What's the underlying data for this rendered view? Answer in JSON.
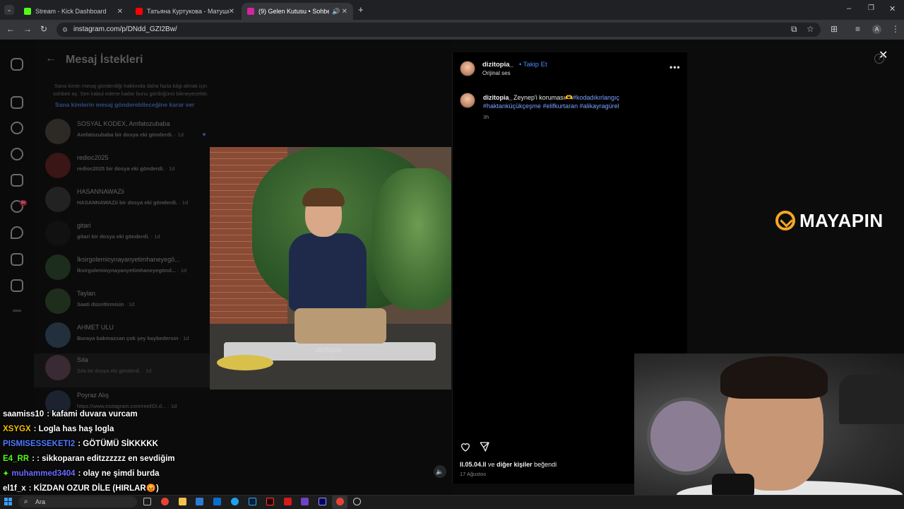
{
  "browser": {
    "tabs": [
      {
        "label": "Stream - Kick Dashboard",
        "color": "#53fc18"
      },
      {
        "label": "Татьяна Куртукова - Матушка",
        "color": "#ff0000"
      },
      {
        "label": "(9) Gelen Kutusu • Sohbetler",
        "color": "#d6249f"
      }
    ],
    "url": "instagram.com/p/DNdd_GZI2Bw/"
  },
  "dm": {
    "title": "Mesaj İstekleri",
    "note": "Sana kimin mesaj gönderdiği hakkında daha fazla bilgi almak için sohbeti aç. Sen kabul edene kadar bunu gördüğünü bilmeyecektir.",
    "link": "Sana kimlerin mesaj gönderebileceğine karar ver",
    "items": [
      {
        "name": "SOSYAL KODEX, Amfatozubaba",
        "msg": "Amfatozubaba bir dosya eki gönderdi.",
        "time": "· 1d"
      },
      {
        "name": "redioc2025",
        "msg": "redioc2025 bir dosya eki gönderdi.",
        "time": "· 1d"
      },
      {
        "name": "HASANNAWAZii",
        "msg": "HASANNAWAZii bir dosya eki gönderdi.",
        "time": "· 1d"
      },
      {
        "name": "gitari",
        "msg": "gitari bir dosya eki gönderdi.",
        "time": "· 1d"
      },
      {
        "name": "İksirgolemioynayanyetimhaneyegö...",
        "msg": "İksirgolemioynayanyetimhaneyegönd...",
        "time": "· 1d"
      },
      {
        "name": "Taylan",
        "msg": "Saati düzeltirmisin",
        "time": "· 1d"
      },
      {
        "name": "AHMET ULU",
        "msg": "Buraya bakmazsan çok şey kaybedersin",
        "time": "· 1d"
      },
      {
        "name": "Sıla",
        "msg": "Sıla bir dosya eki gönderdi.",
        "time": "· 1d"
      },
      {
        "name": "Poyraz Alış",
        "msg": "https://www.instagram.com/reel/DI.d...",
        "time": "· 1d"
      }
    ]
  },
  "video": {
    "watermark": "dizitopia"
  },
  "post": {
    "username": "dizitopia_",
    "follow": "Takip Et",
    "audio": "Orijinal ses",
    "caption_user": "dizitopia_",
    "caption_text": "Zeynep'i koruması🫶",
    "caption_tags_1": "#kodadıkırlangıç",
    "caption_tags_2": "#haktanküçükçeşme #elifkurtaran #alikayragürel",
    "caption_time": "3h",
    "likes_user": "ll.05.04.ll",
    "likes_and": "ve",
    "likes_others": "diğer kişiler",
    "likes_suffix": "beğendi",
    "date": "17 Ağustos"
  },
  "logo": {
    "text": "MAYAPIN",
    "accent": "#f5a623"
  },
  "chat": [
    {
      "user": "saamiss10",
      "color": "#ffffff",
      "text": ": kafami duvara vurcam"
    },
    {
      "user": "XSYGX",
      "color": "#f5c400",
      "text": ": Logla has haş logla"
    },
    {
      "user": "PISMISESSEKETI2",
      "color": "#4f7cff",
      "text": ": GÖTÜMÜ SİKKKKK"
    },
    {
      "user": "E4_RR",
      "color": "#53fc18",
      "text": ": : sikkoparan editzzzzzz en sevdiğim"
    },
    {
      "user": "muhammed3404",
      "color": "#6c6cff",
      "text": ": olay ne şimdi burda",
      "badge": "✦"
    },
    {
      "user": "el1f_x",
      "color": "#ffffff",
      "text": ": KİZDAN OZUR DİLE (HIRLAR😡)"
    }
  ],
  "taskbar": {
    "search_label": "Ara"
  }
}
